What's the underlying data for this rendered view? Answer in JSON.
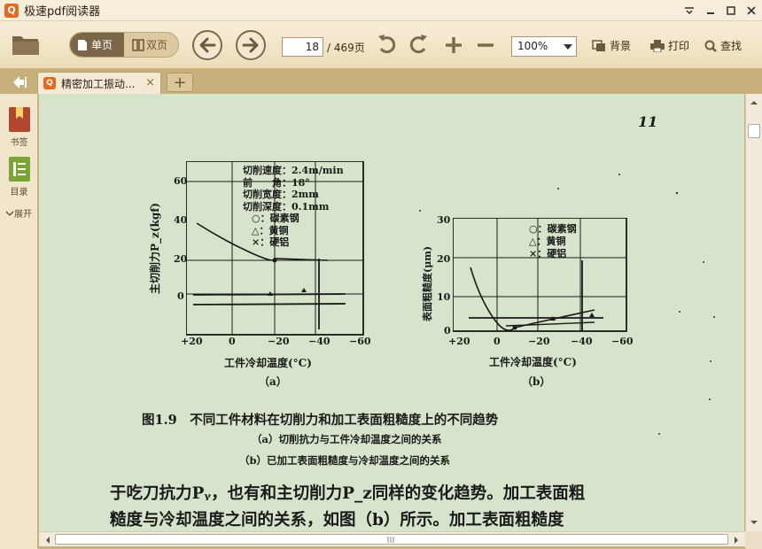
{
  "app": {
    "title": "极速pdf阅读器",
    "logo_glyph": "Q"
  },
  "toolbar": {
    "single_page_label": "单页",
    "double_page_label": "双页",
    "page_current": "18",
    "page_total_text": "/ 469页",
    "zoom_value": "100%",
    "background_label": "背景",
    "print_label": "打印",
    "search_label": "查找"
  },
  "tabs": {
    "active_label": "精密加工振动...",
    "close_glyph": "×",
    "add_glyph": "+"
  },
  "sidebar": {
    "bookmark_label": "书签",
    "toc_label": "目录",
    "expand_label": "展开"
  },
  "colors": {
    "accent": "#e46a1f",
    "content_bg": "#d6e4cc",
    "toolbar_bg": "#f4e9d0",
    "tab_bar": "#c7b07c"
  },
  "document": {
    "page_number": "11",
    "chart_a": {
      "legend": [
        "切削速度：2.4m/min",
        "前　　角：18°",
        "切削宽度：2mm",
        "切削深度：0.1mm",
        "○：碳素钢",
        "△：黄铜",
        "×：硬铝"
      ],
      "ylabel": "主切削力P_z(kgf)",
      "yticks": [
        "60",
        "40",
        "20",
        "0"
      ],
      "xticks": [
        "+20",
        "0",
        "−20",
        "−40",
        "−60"
      ],
      "xlabel": "工件冷却温度(°C)",
      "sub_label": "（a）"
    },
    "chart_b": {
      "legend": [
        "○：碳素钢",
        "△：黄铜",
        "×：硬铝"
      ],
      "ylabel": "表面粗糙度(μm)",
      "yticks": [
        "30",
        "20",
        "10",
        "0"
      ],
      "xticks": [
        "+20",
        "0",
        "−20",
        "−40",
        "−60"
      ],
      "xlabel": "工件冷却温度(°C)",
      "sub_label": "（b）"
    },
    "figure_caption": "图1.9　不同工件材料在切削力和加工表面粗糙度上的不同趋势",
    "caption_a": "（a）切削抗力与工件冷却温度之间的关系",
    "caption_b": "（b）已加工表面粗糙度与冷却温度之间的关系",
    "body_line_1": "于吃刀抗力Pᵧ，也有和主切削力P_z同样的变化趋势。加工表面粗",
    "body_line_2": "糙度与冷却温度之间的关系，如图（b）所示。加工表面粗糙度"
  }
}
